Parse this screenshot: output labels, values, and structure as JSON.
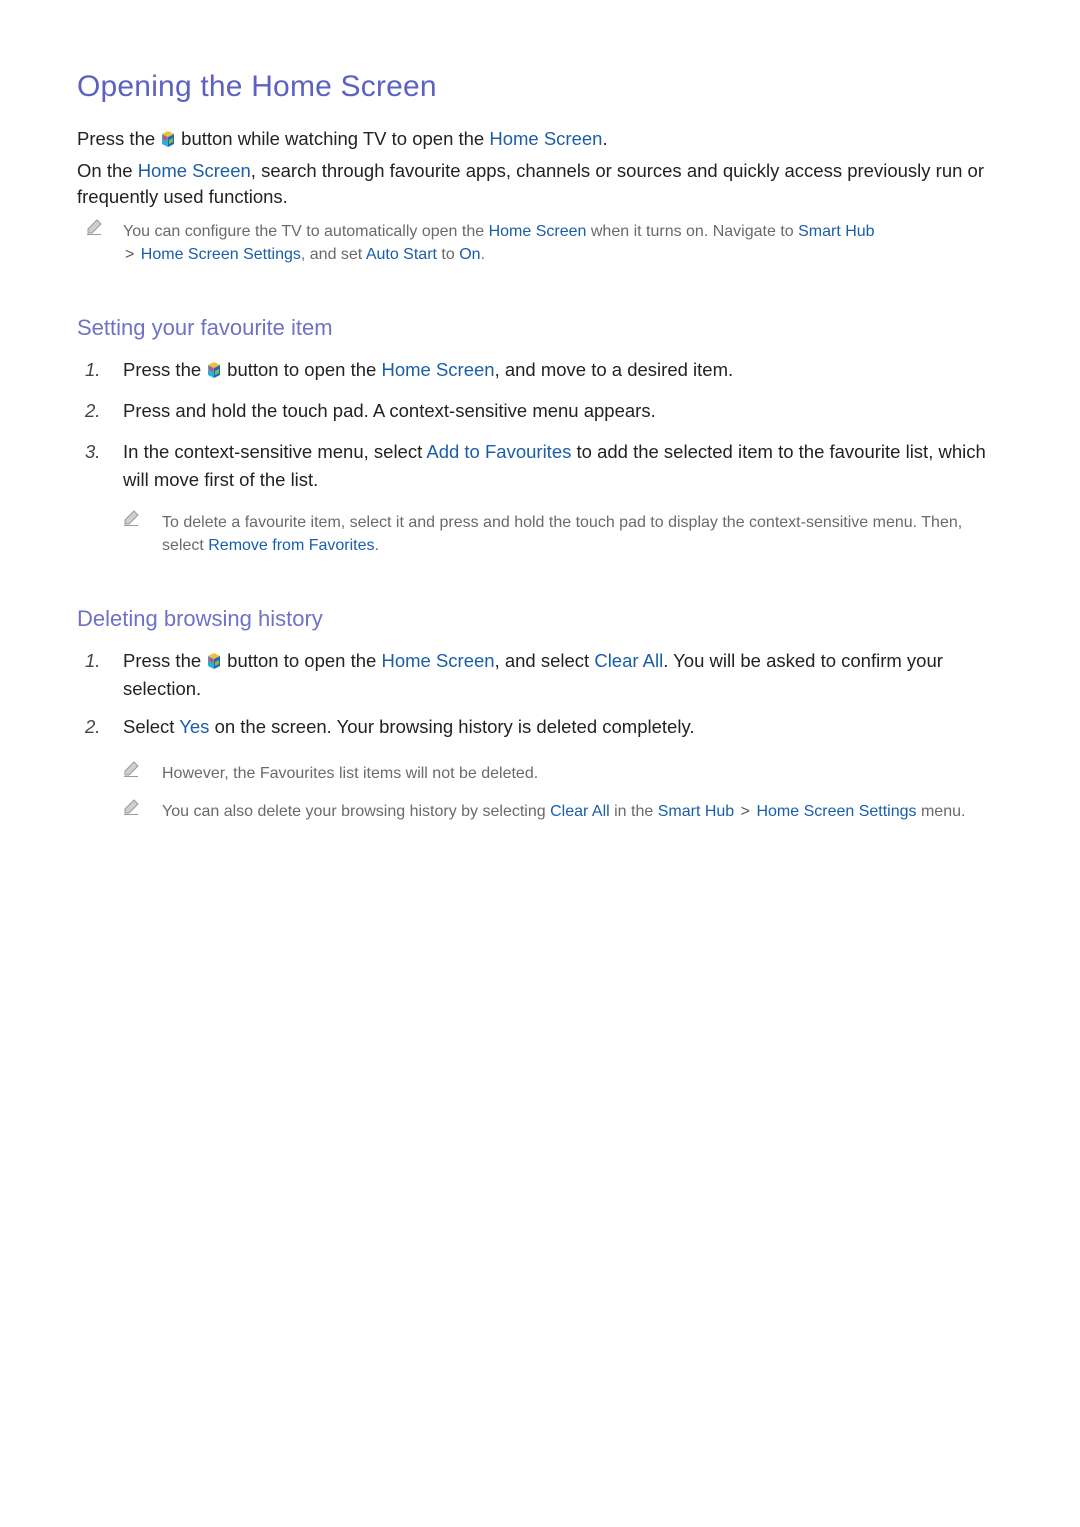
{
  "title": "Opening the Home Screen",
  "intro": {
    "p1": {
      "a": "Press the",
      "b": "button while watching TV to open the",
      "link": "Home Screen",
      "end": "."
    },
    "p2": {
      "a": "On the",
      "link": "Home Screen",
      "b": ", search through favourite apps, channels or sources and quickly access previously run or frequently used functions."
    },
    "note": {
      "a": "You can configure the TV to automatically open the",
      "l1": "Home Screen",
      "b": "when it turns on. Navigate to",
      "l2": "Smart Hub",
      "sep": ">",
      "l3": "Home Screen Settings",
      "c": ", and set",
      "l4": "Auto Start",
      "d": "to",
      "l5": "On",
      "e": "."
    }
  },
  "sections": [
    {
      "heading": "Setting your favourite item",
      "steps": [
        {
          "num": "1.",
          "a": "Press the",
          "b": "button to open the",
          "link": "Home Screen",
          "c": ", and move to a desired item."
        },
        {
          "num": "2.",
          "text": "Press and hold the touch pad. A context-sensitive menu appears."
        },
        {
          "num": "3.",
          "a": "In the context-sensitive menu, select",
          "link": "Add to Favourites",
          "b": "to add the selected item to the favourite list, which will move first of the list."
        }
      ],
      "note": {
        "a": "To delete a favourite item, select it and press and hold the touch pad to display the context-sensitive menu. Then, select",
        "link": "Remove from Favorites",
        "b": "."
      }
    },
    {
      "heading": "Deleting browsing history",
      "steps": [
        {
          "num": "1.",
          "a": "Press the",
          "b": "button to open the",
          "l1": "Home Screen",
          "c": ", and select",
          "l2": "Clear All",
          "d": ". You will be asked to confirm your selection."
        },
        {
          "num": "2.",
          "a": "Select",
          "link": "Yes",
          "b": "on the screen. Your browsing history is deleted completely."
        }
      ],
      "notes": [
        {
          "text": "However, the Favourites list items will not be deleted."
        },
        {
          "a": "You can also delete your browsing history by selecting",
          "l1": "Clear All",
          "b": "in the",
          "l2": "Smart Hub",
          "sep": ">",
          "l3": "Home Screen Settings",
          "c": "menu."
        }
      ]
    }
  ],
  "icons": {
    "hub": "smart-hub-button-icon",
    "note": "pencil-note-icon"
  }
}
